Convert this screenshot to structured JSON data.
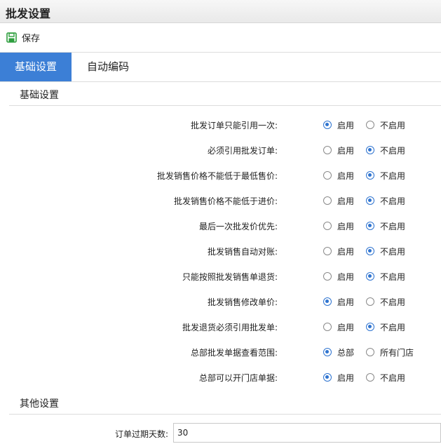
{
  "window": {
    "title": "批发设置"
  },
  "toolbar": {
    "save_label": "保存"
  },
  "tabs": [
    {
      "label": "基础设置",
      "active": true
    },
    {
      "label": "自动编码",
      "active": false
    }
  ],
  "sections": {
    "basic": "基础设置",
    "other": "其他设置"
  },
  "settings": [
    {
      "label": "批发订单只能引用一次:",
      "options": [
        "启用",
        "不启用"
      ],
      "selected": 0
    },
    {
      "label": "必须引用批发订单:",
      "options": [
        "启用",
        "不启用"
      ],
      "selected": 1
    },
    {
      "label": "批发销售价格不能低于最低售价:",
      "options": [
        "启用",
        "不启用"
      ],
      "selected": 1
    },
    {
      "label": "批发销售价格不能低于进价:",
      "options": [
        "启用",
        "不启用"
      ],
      "selected": 1
    },
    {
      "label": "最后一次批发价优先:",
      "options": [
        "启用",
        "不启用"
      ],
      "selected": 1
    },
    {
      "label": "批发销售自动对账:",
      "options": [
        "启用",
        "不启用"
      ],
      "selected": 1
    },
    {
      "label": "只能按照批发销售单退货:",
      "options": [
        "启用",
        "不启用"
      ],
      "selected": 1
    },
    {
      "label": "批发销售修改单价:",
      "options": [
        "启用",
        "不启用"
      ],
      "selected": 0
    },
    {
      "label": "批发退货必须引用批发单:",
      "options": [
        "启用",
        "不启用"
      ],
      "selected": 1
    },
    {
      "label": "总部批发单据查看范围:",
      "options": [
        "总部",
        "所有门店"
      ],
      "selected": 0
    },
    {
      "label": "总部可以开门店单据:",
      "options": [
        "启用",
        "不启用"
      ],
      "selected": 0
    }
  ],
  "other": {
    "expiry_label": "订单过期天数:",
    "expiry_value": "30"
  },
  "colors": {
    "accent": "#3c7fd6",
    "save_icon": "#2e9e3e"
  }
}
